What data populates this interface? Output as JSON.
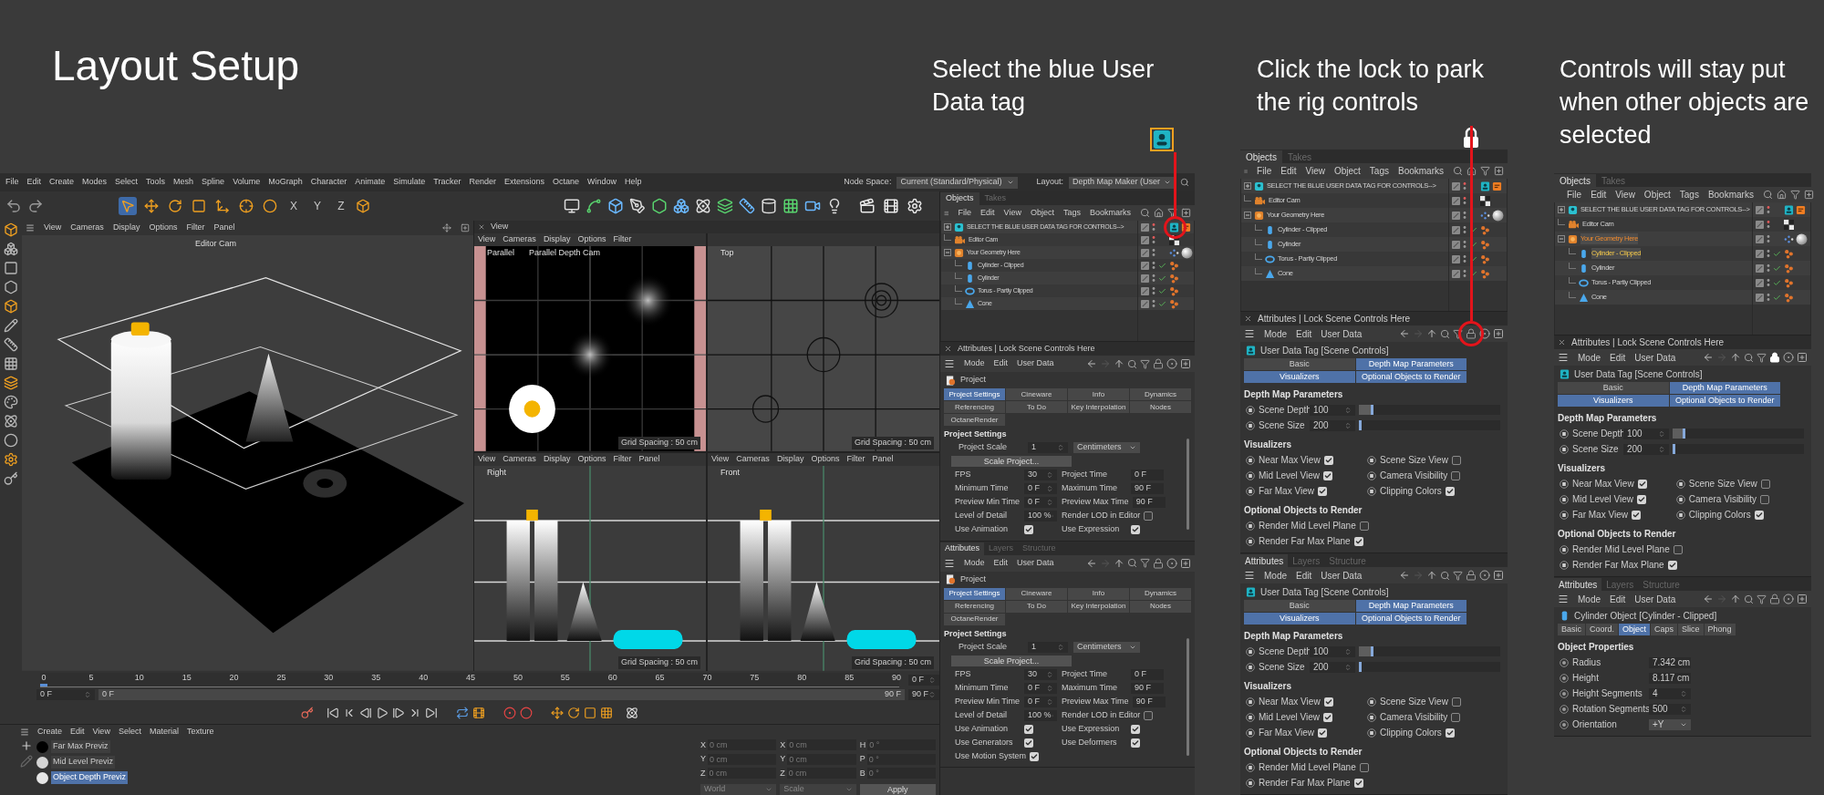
{
  "title": "Layout Setup",
  "main": {
    "caption": "Select the blue User Data tag",
    "menu": [
      "File",
      "Edit",
      "Create",
      "Modes",
      "Select",
      "Tools",
      "Mesh",
      "Spline",
      "Volume",
      "MoGraph",
      "Character",
      "Animate",
      "Simulate",
      "Tracker",
      "Render",
      "Extensions",
      "Octane",
      "Window",
      "Help"
    ],
    "node_space": {
      "label": "Node Space:",
      "value": "Current (Standard/Physical)"
    },
    "layout": {
      "label": "Layout:",
      "value": "Depth Map Maker (User"
    },
    "axis_locks": [
      "X",
      "Y",
      "Z"
    ],
    "perspective": {
      "menu": [
        "View",
        "Cameras",
        "Display",
        "Options",
        "Filter",
        "Panel"
      ],
      "camera": "Editor Cam"
    },
    "view_window": {
      "title": "View"
    },
    "viewports": [
      {
        "kind": "parallel",
        "menu": [
          "View",
          "Cameras",
          "Display",
          "Options",
          "Filter"
        ],
        "name": "Parallel",
        "camera": "Parallel Depth Cam",
        "grid": "Grid Spacing : 50 cm"
      },
      {
        "kind": "top",
        "name": "Top",
        "grid": "Grid Spacing : 50 cm"
      },
      {
        "kind": "right",
        "menu": [
          "View",
          "Cameras",
          "Display",
          "Options",
          "Filter",
          "Panel"
        ],
        "name": "Right",
        "grid": "Grid Spacing : 50 cm"
      },
      {
        "kind": "front",
        "menu": [
          "View",
          "Cameras",
          "Display",
          "Options",
          "Filter",
          "Panel"
        ],
        "name": "Front",
        "grid": "Grid Spacing : 50 cm"
      }
    ],
    "timeline": {
      "ticks": [
        "0",
        "5",
        "10",
        "15",
        "20",
        "25",
        "30",
        "35",
        "40",
        "45",
        "50",
        "55",
        "60",
        "65",
        "70",
        "75",
        "80",
        "85",
        "90"
      ],
      "current_frame": "0 F",
      "start": "0 F",
      "range": {
        "start": "0 F",
        "end": "90 F",
        "level": 1
      },
      "end": "90 F"
    },
    "materials": {
      "menu": [
        "Create",
        "Edit",
        "View",
        "Select",
        "Material",
        "Texture"
      ],
      "items": [
        {
          "name": "Far Max Previz",
          "color": "#000000",
          "selected": false
        },
        {
          "name": "Mid Level Previz",
          "color": "#d4d4d4",
          "selected": false
        },
        {
          "name": "Object Depth Previz",
          "color": "#e6e6e6",
          "selected": true
        }
      ]
    },
    "coordinates": {
      "rows": [
        {
          "position_axis": "X",
          "position": "0 cm",
          "size_axis": "X",
          "size": "0 cm",
          "rotation_axis": "H",
          "rotation": "0 °"
        },
        {
          "position_axis": "Y",
          "position": "0 cm",
          "size_axis": "Y",
          "size": "0 cm",
          "rotation_axis": "P",
          "rotation": "0 °"
        },
        {
          "position_axis": "Z",
          "position": "0 cm",
          "size_axis": "Z",
          "size": "0 cm",
          "rotation_axis": "B",
          "rotation": "0 °"
        }
      ],
      "mode": "World",
      "size_mode": "Scale",
      "apply": "Apply"
    },
    "objects": {
      "tabs": [
        {
          "label": "Objects",
          "selected": true
        },
        {
          "label": "Takes",
          "selected": false
        }
      ],
      "menu": [
        "File",
        "Edit",
        "View",
        "Object",
        "Tags",
        "Bookmarks"
      ],
      "rows": [
        {
          "name": "SELECT THE BLUE USER DATA TAG FOR CONTROLS-->",
          "kind": "controls",
          "expanded": false,
          "selected": false,
          "active": false
        },
        {
          "name": "Editor Cam",
          "kind": "camera",
          "selected": false,
          "active": false
        },
        {
          "name": "Your Geometry Here",
          "kind": "group",
          "expanded": true,
          "selected": false,
          "active": false,
          "children": [
            {
              "name": "Cylinder - Clipped",
              "kind": "cylinder",
              "selected": false,
              "active": false
            },
            {
              "name": "Cylinder",
              "kind": "cylinder",
              "selected": false,
              "active": false
            },
            {
              "name": "Torus - Partly Clipped",
              "kind": "torus",
              "selected": false,
              "active": false
            },
            {
              "name": "Cone",
              "kind": "cone",
              "selected": false,
              "active": false
            }
          ]
        }
      ]
    },
    "attributes": [
      {
        "title": "Attributes | Lock Scene Controls Here",
        "menu": [
          "Mode",
          "Edit",
          "User Data"
        ],
        "locked": false,
        "object": {
          "kind": "project",
          "name": "Project"
        },
        "page_tabs": {
          "items": [
            {
              "label": "Project Settings",
              "selected": true
            },
            {
              "label": "Cineware",
              "selected": false
            },
            {
              "label": "Info",
              "selected": false
            },
            {
              "label": "Dynamics",
              "selected": false
            },
            {
              "label": "Referencing",
              "selected": false
            },
            {
              "label": "To Do",
              "selected": false
            },
            {
              "label": "Key Interpolation",
              "selected": false
            },
            {
              "label": "Nodes",
              "selected": false
            },
            {
              "label": "OctaneRender",
              "selected": false
            }
          ]
        },
        "sections": [
          {
            "title": "Project Settings",
            "rows": [
              {
                "kind": "unit_field",
                "label": "Project Scale",
                "value": "1",
                "unit": "Centimeters"
              },
              {
                "kind": "button",
                "label": "Scale Project..."
              },
              {
                "kind": "pair",
                "items": [
                  {
                    "kind": "value",
                    "label": "FPS",
                    "value": "30"
                  },
                  {
                    "kind": "value",
                    "label": "Project Time",
                    "value": "0 F"
                  }
                ]
              },
              {
                "kind": "pair",
                "items": [
                  {
                    "kind": "value",
                    "label": "Minimum Time",
                    "value": "0 F"
                  },
                  {
                    "kind": "value",
                    "label": "Maximum Time",
                    "value": "90 F"
                  }
                ]
              },
              {
                "kind": "pair",
                "items": [
                  {
                    "kind": "value",
                    "label": "Preview Min Time",
                    "value": "0 F"
                  },
                  {
                    "kind": "value",
                    "label": "Preview Max Time",
                    "value": "90 F"
                  }
                ]
              },
              {
                "kind": "pair",
                "items": [
                  {
                    "kind": "value",
                    "label": "Level of Detail",
                    "value": "100 %"
                  },
                  {
                    "kind": "check",
                    "label": "Render LOD in Editor",
                    "checked": false
                  }
                ]
              },
              {
                "kind": "pair",
                "items": [
                  {
                    "kind": "check",
                    "label": "Use Animation",
                    "checked": true
                  },
                  {
                    "kind": "check",
                    "label": "Use Expression",
                    "checked": true
                  }
                ]
              }
            ]
          }
        ]
      },
      {
        "tabs": [
          {
            "label": "Attributes",
            "selected": true
          },
          {
            "label": "Layers",
            "selected": false
          },
          {
            "label": "Structure",
            "selected": false
          }
        ],
        "menu": [
          "Mode",
          "Edit",
          "User Data"
        ],
        "locked": false,
        "object": {
          "kind": "project",
          "name": "Project"
        },
        "page_tabs": {
          "items": [
            {
              "label": "Project Settings",
              "selected": true
            },
            {
              "label": "Cineware",
              "selected": false
            },
            {
              "label": "Info",
              "selected": false
            },
            {
              "label": "Dynamics",
              "selected": false
            },
            {
              "label": "Referencing",
              "selected": false
            },
            {
              "label": "To Do",
              "selected": false
            },
            {
              "label": "Key Interpolation",
              "selected": false
            },
            {
              "label": "Nodes",
              "selected": false
            },
            {
              "label": "OctaneRender",
              "selected": false
            }
          ]
        },
        "sections": [
          {
            "title": "Project Settings",
            "rows": [
              {
                "kind": "unit_field",
                "label": "Project Scale",
                "value": "1",
                "unit": "Centimeters"
              },
              {
                "kind": "button",
                "label": "Scale Project..."
              },
              {
                "kind": "pair",
                "items": [
                  {
                    "kind": "value",
                    "label": "FPS",
                    "value": "30"
                  },
                  {
                    "kind": "value",
                    "label": "Project Time",
                    "value": "0 F"
                  }
                ]
              },
              {
                "kind": "pair",
                "items": [
                  {
                    "kind": "value",
                    "label": "Minimum Time",
                    "value": "0 F"
                  },
                  {
                    "kind": "value",
                    "label": "Maximum Time",
                    "value": "90 F"
                  }
                ]
              },
              {
                "kind": "pair",
                "items": [
                  {
                    "kind": "value",
                    "label": "Preview Min Time",
                    "value": "0 F"
                  },
                  {
                    "kind": "value",
                    "label": "Preview Max Time",
                    "value": "90 F"
                  }
                ]
              },
              {
                "kind": "pair",
                "items": [
                  {
                    "kind": "value",
                    "label": "Level of Detail",
                    "value": "100 %"
                  },
                  {
                    "kind": "check",
                    "label": "Render LOD in Editor",
                    "checked": false
                  }
                ]
              },
              {
                "kind": "pair",
                "items": [
                  {
                    "kind": "check",
                    "label": "Use Animation",
                    "checked": true
                  },
                  {
                    "kind": "check",
                    "label": "Use Expression",
                    "checked": true
                  }
                ]
              },
              {
                "kind": "pair",
                "items": [
                  {
                    "kind": "check",
                    "label": "Use Generators",
                    "checked": true
                  },
                  {
                    "kind": "check",
                    "label": "Use Deformers",
                    "checked": true
                  }
                ]
              },
              {
                "kind": "pair",
                "items": [
                  {
                    "kind": "check",
                    "label": "Use Motion System",
                    "checked": true
                  }
                ]
              }
            ]
          }
        ]
      }
    ]
  },
  "step2": {
    "caption": "Click the lock to park the rig controls",
    "objects": {
      "tabs": [
        {
          "label": "Objects",
          "selected": true
        },
        {
          "label": "Takes",
          "selected": false
        }
      ],
      "menu": [
        "File",
        "Edit",
        "View",
        "Object",
        "Tags",
        "Bookmarks"
      ],
      "rows": [
        {
          "name": "SELECT THE BLUE USER DATA TAG FOR CONTROLS-->",
          "kind": "controls",
          "expanded": false,
          "selected": false,
          "active": false
        },
        {
          "name": "Editor Cam",
          "kind": "camera",
          "selected": false,
          "active": false
        },
        {
          "name": "Your Geometry Here",
          "kind": "group",
          "expanded": true,
          "selected": false,
          "active": false,
          "children": [
            {
              "name": "Cylinder - Clipped",
              "kind": "cylinder",
              "selected": false,
              "active": false
            },
            {
              "name": "Cylinder",
              "kind": "cylinder",
              "selected": false,
              "active": false
            },
            {
              "name": "Torus - Partly Clipped",
              "kind": "torus",
              "selected": false,
              "active": false
            },
            {
              "name": "Cone",
              "kind": "cone",
              "selected": false,
              "active": false
            }
          ]
        }
      ]
    },
    "attributes": [
      {
        "title": "Attributes | Lock Scene Controls Here",
        "menu": [
          "Mode",
          "Edit",
          "User Data"
        ],
        "locked": false,
        "object": {
          "kind": "user_data",
          "name": "User Data Tag [Scene Controls]"
        },
        "page_tabs": {
          "items": [
            {
              "label": "Basic",
              "selected": false
            },
            {
              "label": "Depth Map Parameters",
              "selected": true
            },
            {
              "label": "Visualizers",
              "selected": true
            },
            {
              "label": "Optional Objects to Render",
              "selected": true
            }
          ]
        },
        "sections": [
          {
            "title": "Depth Map Parameters",
            "rows": [
              {
                "kind": "key_slider",
                "label": "Scene Depth",
                "value": "100",
                "level": 0.1
              },
              {
                "kind": "key_slider",
                "label": "Scene Size",
                "value": "200",
                "level": 0.015
              }
            ]
          },
          {
            "title": "Visualizers",
            "rows": [
              {
                "kind": "key_pair",
                "items": [
                  {
                    "label": "Near Max View",
                    "checked": true
                  },
                  {
                    "label": "Scene Size View",
                    "checked": false
                  }
                ]
              },
              {
                "kind": "key_pair",
                "items": [
                  {
                    "label": "Mid Level View",
                    "checked": true
                  },
                  {
                    "label": "Camera Visibility",
                    "checked": false
                  }
                ]
              },
              {
                "kind": "key_pair",
                "items": [
                  {
                    "label": "Far Max View",
                    "checked": true
                  },
                  {
                    "label": "Clipping Colors",
                    "checked": true
                  }
                ]
              }
            ]
          },
          {
            "title": "Optional Objects to Render",
            "rows": [
              {
                "kind": "key_check",
                "label": "Render Mid Level Plane",
                "checked": false
              },
              {
                "kind": "key_check",
                "label": "Render Far Max Plane",
                "checked": true
              }
            ]
          }
        ]
      },
      {
        "tabs": [
          {
            "label": "Attributes",
            "selected": true
          },
          {
            "label": "Layers",
            "selected": false
          },
          {
            "label": "Structure",
            "selected": false
          }
        ],
        "menu": [
          "Mode",
          "Edit",
          "User Data"
        ],
        "locked": false,
        "object": {
          "kind": "user_data",
          "name": "User Data Tag [Scene Controls]"
        },
        "page_tabs": {
          "items": [
            {
              "label": "Basic",
              "selected": false
            },
            {
              "label": "Depth Map Parameters",
              "selected": true
            },
            {
              "label": "Visualizers",
              "selected": true
            },
            {
              "label": "Optional Objects to Render",
              "selected": true
            }
          ]
        },
        "sections": [
          {
            "title": "Depth Map Parameters",
            "rows": [
              {
                "kind": "key_slider",
                "label": "Scene Depth",
                "value": "100",
                "level": 0.1
              },
              {
                "kind": "key_slider",
                "label": "Scene Size",
                "value": "200",
                "level": 0.015
              }
            ]
          },
          {
            "title": "Visualizers",
            "rows": [
              {
                "kind": "key_pair",
                "items": [
                  {
                    "label": "Near Max View",
                    "checked": true
                  },
                  {
                    "label": "Scene Size View",
                    "checked": false
                  }
                ]
              },
              {
                "kind": "key_pair",
                "items": [
                  {
                    "label": "Mid Level View",
                    "checked": true
                  },
                  {
                    "label": "Camera Visibility",
                    "checked": false
                  }
                ]
              },
              {
                "kind": "key_pair",
                "items": [
                  {
                    "label": "Far Max View",
                    "checked": true
                  },
                  {
                    "label": "Clipping Colors",
                    "checked": true
                  }
                ]
              }
            ]
          },
          {
            "title": "Optional Objects to Render",
            "rows": [
              {
                "kind": "key_check",
                "label": "Render Mid Level Plane",
                "checked": false
              },
              {
                "kind": "key_check",
                "label": "Render Far Max Plane",
                "checked": true
              }
            ]
          }
        ]
      }
    ]
  },
  "step3": {
    "caption": "Controls will stay put when other objects are selected",
    "objects": {
      "tabs": [
        {
          "label": "Objects",
          "selected": true
        },
        {
          "label": "Takes",
          "selected": false
        }
      ],
      "menu": [
        "File",
        "Edit",
        "View",
        "Object",
        "Tags",
        "Bookmarks"
      ],
      "rows": [
        {
          "name": "SELECT THE BLUE USER DATA TAG FOR CONTROLS-->",
          "kind": "controls",
          "expanded": false,
          "selected": false,
          "active": false
        },
        {
          "name": "Editor Cam",
          "kind": "camera",
          "selected": false,
          "active": false
        },
        {
          "name": "Your Geometry Here",
          "kind": "group",
          "expanded": true,
          "selected": true,
          "active": false,
          "children": [
            {
              "name": "Cylinder - Clipped",
              "kind": "cylinder",
              "selected": true,
              "active": true
            },
            {
              "name": "Cylinder",
              "kind": "cylinder",
              "selected": false,
              "active": false
            },
            {
              "name": "Torus - Partly Clipped",
              "kind": "torus",
              "selected": false,
              "active": false
            },
            {
              "name": "Cone",
              "kind": "cone",
              "selected": false,
              "active": false
            }
          ]
        }
      ]
    },
    "attributes": [
      {
        "title": "Attributes | Lock Scene Controls Here",
        "menu": [
          "Mode",
          "Edit",
          "User Data"
        ],
        "locked": true,
        "object": {
          "kind": "user_data",
          "name": "User Data Tag [Scene Controls]"
        },
        "page_tabs": {
          "items": [
            {
              "label": "Basic",
              "selected": false
            },
            {
              "label": "Depth Map Parameters",
              "selected": true
            },
            {
              "label": "Visualizers",
              "selected": true
            },
            {
              "label": "Optional Objects to Render",
              "selected": true
            }
          ]
        },
        "sections": [
          {
            "title": "Depth Map Parameters",
            "rows": [
              {
                "kind": "key_slider",
                "label": "Scene Depth",
                "value": "100",
                "level": 0.1
              },
              {
                "kind": "key_slider",
                "label": "Scene Size",
                "value": "200",
                "level": 0.015
              }
            ]
          },
          {
            "title": "Visualizers",
            "rows": [
              {
                "kind": "key_pair",
                "items": [
                  {
                    "label": "Near Max View",
                    "checked": true
                  },
                  {
                    "label": "Scene Size View",
                    "checked": false
                  }
                ]
              },
              {
                "kind": "key_pair",
                "items": [
                  {
                    "label": "Mid Level View",
                    "checked": true
                  },
                  {
                    "label": "Camera Visibility",
                    "checked": false
                  }
                ]
              },
              {
                "kind": "key_pair",
                "items": [
                  {
                    "label": "Far Max View",
                    "checked": true
                  },
                  {
                    "label": "Clipping Colors",
                    "checked": true
                  }
                ]
              }
            ]
          },
          {
            "title": "Optional Objects to Render",
            "rows": [
              {
                "kind": "key_check",
                "label": "Render Mid Level Plane",
                "checked": false
              },
              {
                "kind": "key_check",
                "label": "Render Far Max Plane",
                "checked": true
              }
            ]
          }
        ]
      },
      {
        "tabs": [
          {
            "label": "Attributes",
            "selected": true
          },
          {
            "label": "Layers",
            "selected": false
          },
          {
            "label": "Structure",
            "selected": false
          }
        ],
        "menu": [
          "Mode",
          "Edit",
          "User Data"
        ],
        "locked": false,
        "object": {
          "kind": "cylinder",
          "name": "Cylinder Object [Cylinder - Clipped]"
        },
        "page_tabs": {
          "items": [
            {
              "label": "Basic",
              "selected": false
            },
            {
              "label": "Coord.",
              "selected": false
            },
            {
              "label": "Object",
              "selected": true
            },
            {
              "label": "Caps",
              "selected": false
            },
            {
              "label": "Slice",
              "selected": false
            },
            {
              "label": "Phong",
              "selected": false
            }
          ]
        },
        "sections": [
          {
            "title": "Object Properties",
            "rows": [
              {
                "kind": "key_field",
                "label": "Radius",
                "value": "7.342 cm"
              },
              {
                "kind": "key_field",
                "label": "Height",
                "value": "8.117 cm"
              },
              {
                "kind": "key_field",
                "label": "Height Segments",
                "value": "4"
              },
              {
                "kind": "key_field",
                "label": "Rotation Segments",
                "value": "500"
              },
              {
                "kind": "key_dropdown",
                "label": "Orientation",
                "value": "+Y"
              }
            ]
          }
        ]
      }
    ]
  }
}
